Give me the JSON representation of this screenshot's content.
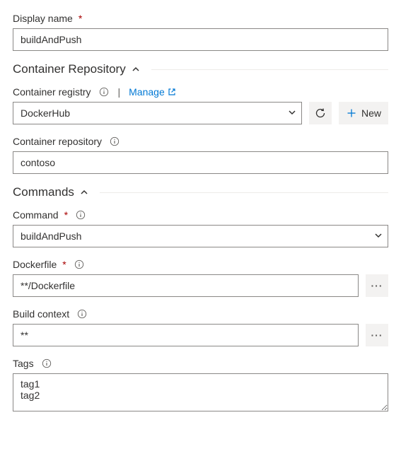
{
  "displayName": {
    "label": "Display name",
    "value": "buildAndPush"
  },
  "sections": {
    "containerRepository": {
      "title": "Container Repository"
    },
    "commands": {
      "title": "Commands"
    }
  },
  "containerRegistry": {
    "label": "Container registry",
    "value": "DockerHub",
    "manageLabel": "Manage",
    "newLabel": "New"
  },
  "containerRepositoryField": {
    "label": "Container repository",
    "value": "contoso"
  },
  "command": {
    "label": "Command",
    "value": "buildAndPush"
  },
  "dockerfile": {
    "label": "Dockerfile",
    "value": "**/Dockerfile"
  },
  "buildContext": {
    "label": "Build context",
    "value": "**"
  },
  "tags": {
    "label": "Tags",
    "value": "tag1\ntag2"
  }
}
